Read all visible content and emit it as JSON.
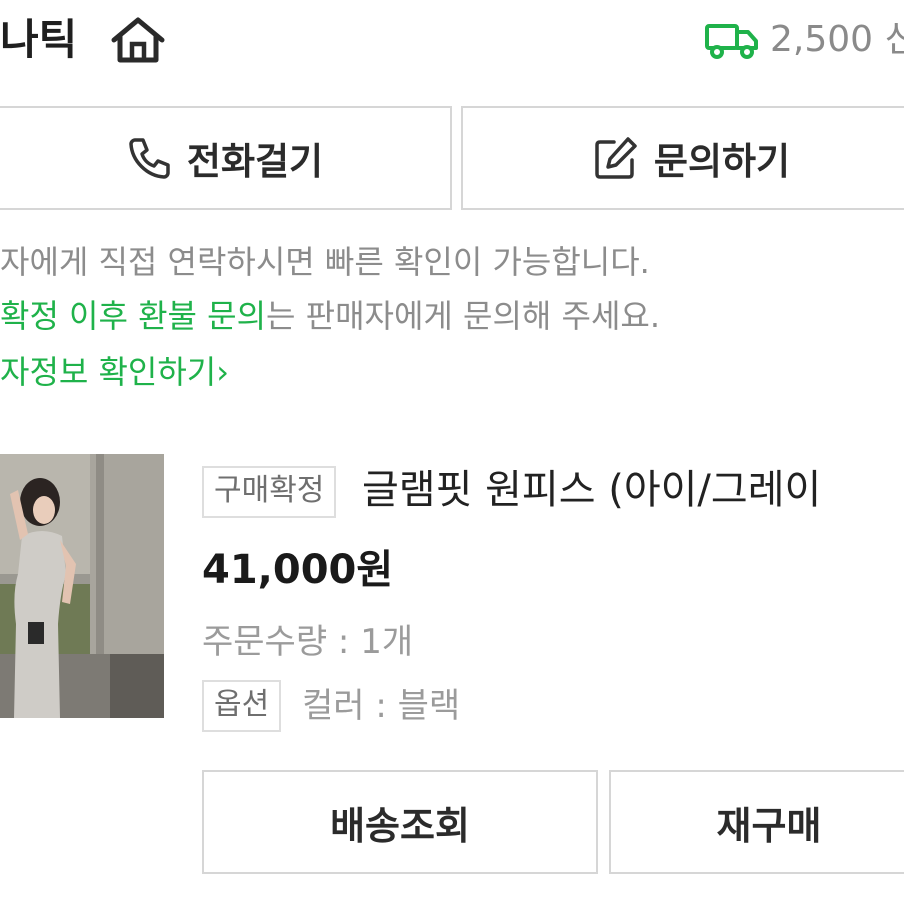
{
  "header": {
    "store_name": "나틱",
    "home_icon": "home-icon",
    "shipping_icon": "truck-icon",
    "shipping_text": "2,500 신",
    "shipping_icon_color": "#1fb24a"
  },
  "contact": {
    "call_label": "전화걸기",
    "call_icon": "phone-icon",
    "inquiry_label": "문의하기",
    "inquiry_icon": "edit-icon"
  },
  "notices": {
    "line1": "자에게 직접 연락하시면 빠른 확인이 가능합니다.",
    "line2_highlight": "확정 이후 환불 문의",
    "line2_rest": "는 판매자에게 문의해 주세요.",
    "seller_info_link": "자정보 확인하기",
    "seller_info_chevron": "›",
    "accent_color": "#1fb24a"
  },
  "product": {
    "status_tag": "구매확정",
    "title": "글램핏 원피스 (아이/그레이",
    "price": "41,000원",
    "quantity": "주문수량 : 1개",
    "option_tag": "옵션",
    "option_value": "컬러 : 블랙"
  },
  "actions": {
    "track_label": "배송조회",
    "rebuy_label": "재구매"
  }
}
